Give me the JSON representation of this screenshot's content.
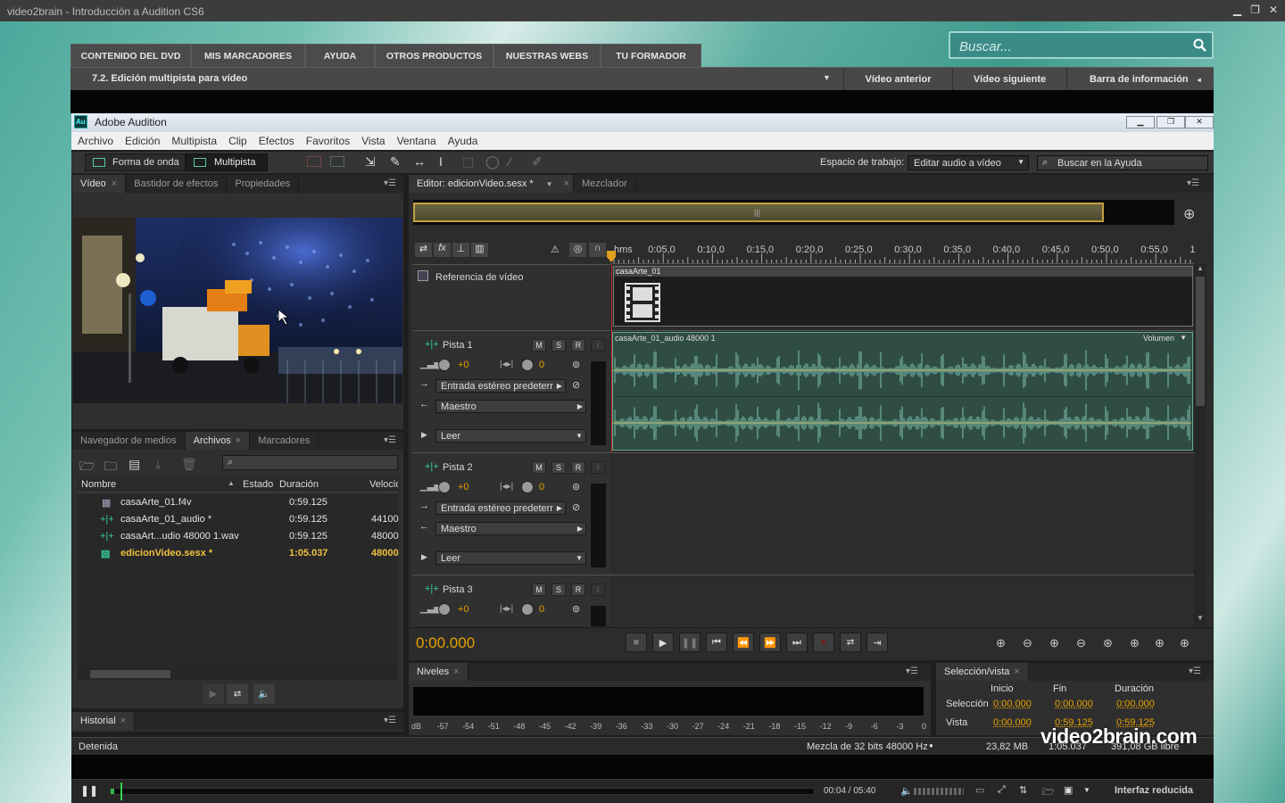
{
  "outer_window": {
    "title": "video2brain - Introducción a Audition CS6"
  },
  "v2b": {
    "nav_tabs": [
      "CONTENIDO DEL DVD",
      "MIS MARCADORES",
      "AYUDA",
      "OTROS PRODUCTOS",
      "NUESTRAS WEBS",
      "TU FORMADOR"
    ],
    "search_placeholder": "Buscar...",
    "lesson": "7.2.  Edición multipista para vídeo",
    "prev_video": "Vídeo anterior",
    "next_video": "Vídeo siguiente",
    "info_bar": "Barra de información",
    "watermark": "video2brain.com"
  },
  "audition": {
    "title": "Adobe Audition",
    "menu": [
      "Archivo",
      "Edición",
      "Multipista",
      "Clip",
      "Efectos",
      "Favoritos",
      "Vista",
      "Ventana",
      "Ayuda"
    ],
    "toolbar": {
      "waveform": "Forma de onda",
      "multitrack": "Multipista",
      "workspace_label": "Espacio de trabajo:",
      "workspace_value": "Editar audio a vídeo",
      "help_search": "Buscar en la Ayuda"
    },
    "video_panel": {
      "tabs": [
        "Vídeo",
        "Bastidor de efectos",
        "Propiedades"
      ]
    },
    "files_panel": {
      "tabs": [
        "Navegador de medios",
        "Archivos",
        "Marcadores"
      ],
      "columns": [
        "Nombre",
        "Estado",
        "Duración",
        "Velocid"
      ],
      "rows": [
        {
          "name": "casaArte_01.f4v",
          "duration": "0:59.125",
          "rate": "",
          "type": "video"
        },
        {
          "name": "casaArte_01_audio *",
          "duration": "0:59.125",
          "rate": "44100",
          "type": "audio"
        },
        {
          "name": "casaArt...udio 48000 1.wav",
          "duration": "0:59.125",
          "rate": "48000",
          "type": "audio"
        },
        {
          "name": "edicionVideo.sesx *",
          "duration": "1:05.037",
          "rate": "48000",
          "type": "session",
          "highlighted": true
        }
      ]
    },
    "history_panel": {
      "tab": "Historial"
    },
    "editor": {
      "tabs": [
        "Editor: edicionVideo.sesx *",
        "Mezclador"
      ],
      "ruler": [
        "hms",
        "0:05,0",
        "0:10,0",
        "0:15,0",
        "0:20,0",
        "0:25,0",
        "0:30,0",
        "0:35,0",
        "0:40,0",
        "0:45,0",
        "0:50,0",
        "0:55,0",
        "1"
      ],
      "video_ref_label": "Referencia de vídeo",
      "video_clip_name": "casaArte_01",
      "audio_clip_name": "casaArte_01_audio 48000 1",
      "volume_label": "Volumen",
      "tracks": [
        {
          "name": "Pista 1",
          "vol": "+0",
          "pan": "0",
          "input": "Entrada estéreo predeterr",
          "output": "Maestro",
          "mode": "Leer"
        },
        {
          "name": "Pista 2",
          "vol": "+0",
          "pan": "0",
          "input": "Entrada estéreo predeterr",
          "output": "Maestro",
          "mode": "Leer"
        },
        {
          "name": "Pista 3",
          "vol": "+0",
          "pan": "0"
        }
      ],
      "msr": [
        "M",
        "S",
        "R",
        "I"
      ],
      "time_display": "0:00.000"
    },
    "levels_panel": {
      "tab": "Niveles",
      "scale": [
        "dB",
        "-57",
        "-54",
        "-51",
        "-48",
        "-45",
        "-42",
        "-39",
        "-36",
        "-33",
        "-30",
        "-27",
        "-24",
        "-21",
        "-18",
        "-15",
        "-12",
        "-9",
        "-6",
        "-3",
        "0"
      ]
    },
    "selection_panel": {
      "tab": "Selección/vista",
      "cols": [
        "Inicio",
        "Fin",
        "Duración"
      ],
      "selection_label": "Selección",
      "view_label": "Vista",
      "selection": [
        "0:00.000",
        "0:00.000",
        "0:00.000"
      ],
      "view": [
        "0:00.000",
        "0:59.125",
        "0:59.125"
      ]
    },
    "status": {
      "state": "Detenida",
      "mix": "Mezcla de 32 bits 48000 Hz",
      "size": "23,82 MB",
      "duration": "1:05.037",
      "free": "391,08 GB libre"
    }
  },
  "player": {
    "time": "00:04 / 05:40",
    "progress": 0.005,
    "reduced_ui": "Interfaz reducida"
  }
}
